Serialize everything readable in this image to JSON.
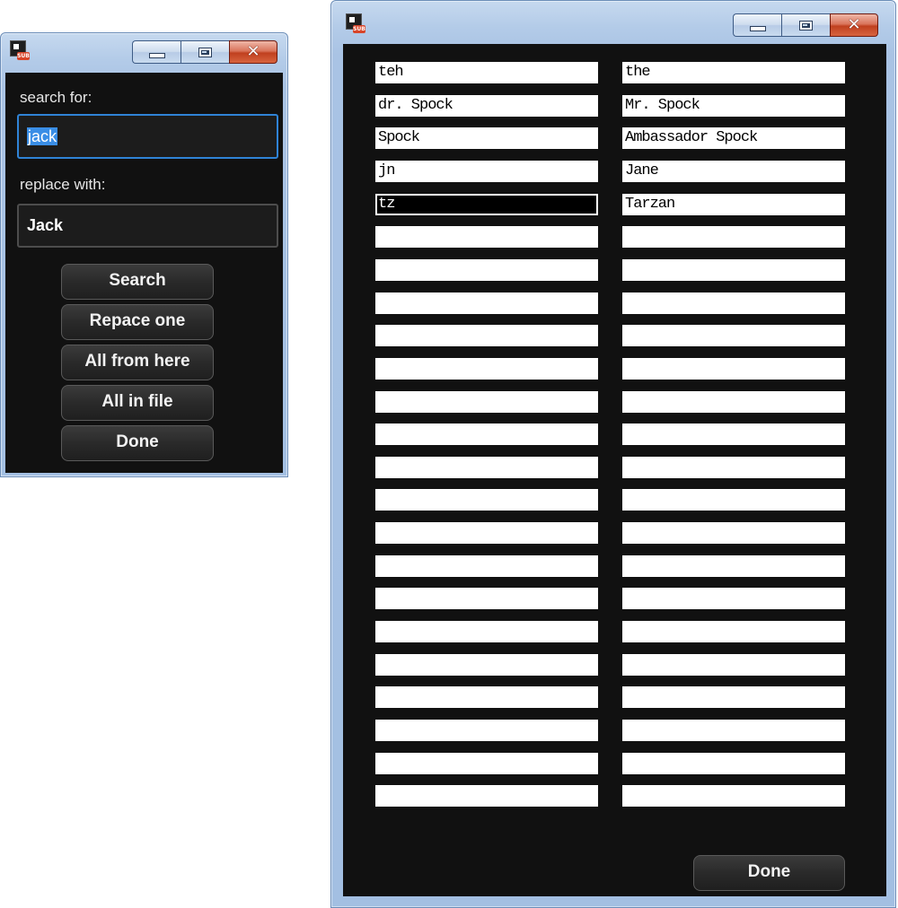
{
  "search_window": {
    "search_label": "search for:",
    "search_value": "jack",
    "replace_label": "replace with:",
    "replace_value": "Jack",
    "buttons": [
      "Search",
      "Repace one",
      "All from here",
      "All in file",
      "Done"
    ],
    "icon_badge": "SUB"
  },
  "dictionary_window": {
    "icon_badge": "SUB",
    "rows": [
      {
        "find": "teh",
        "replace": "the"
      },
      {
        "find": "dr. Spock",
        "replace": "Mr. Spock"
      },
      {
        "find": "Spock",
        "replace": "Ambassador Spock"
      },
      {
        "find": "jn",
        "replace": "Jane"
      },
      {
        "find": "tz",
        "replace": "Tarzan"
      },
      {
        "find": "",
        "replace": ""
      },
      {
        "find": "",
        "replace": ""
      },
      {
        "find": "",
        "replace": ""
      },
      {
        "find": "",
        "replace": ""
      },
      {
        "find": "",
        "replace": ""
      },
      {
        "find": "",
        "replace": ""
      },
      {
        "find": "",
        "replace": ""
      },
      {
        "find": "",
        "replace": ""
      },
      {
        "find": "",
        "replace": ""
      },
      {
        "find": "",
        "replace": ""
      },
      {
        "find": "",
        "replace": ""
      },
      {
        "find": "",
        "replace": ""
      },
      {
        "find": "",
        "replace": ""
      },
      {
        "find": "",
        "replace": ""
      },
      {
        "find": "",
        "replace": ""
      },
      {
        "find": "",
        "replace": ""
      },
      {
        "find": "",
        "replace": ""
      },
      {
        "find": "",
        "replace": ""
      }
    ],
    "active_row": 4,
    "done_label": "Done"
  },
  "colors": {
    "client_bg": "#111111",
    "focus_border": "#2f83d6",
    "selection": "#3a8ee6",
    "close_button": "#c0401f"
  }
}
